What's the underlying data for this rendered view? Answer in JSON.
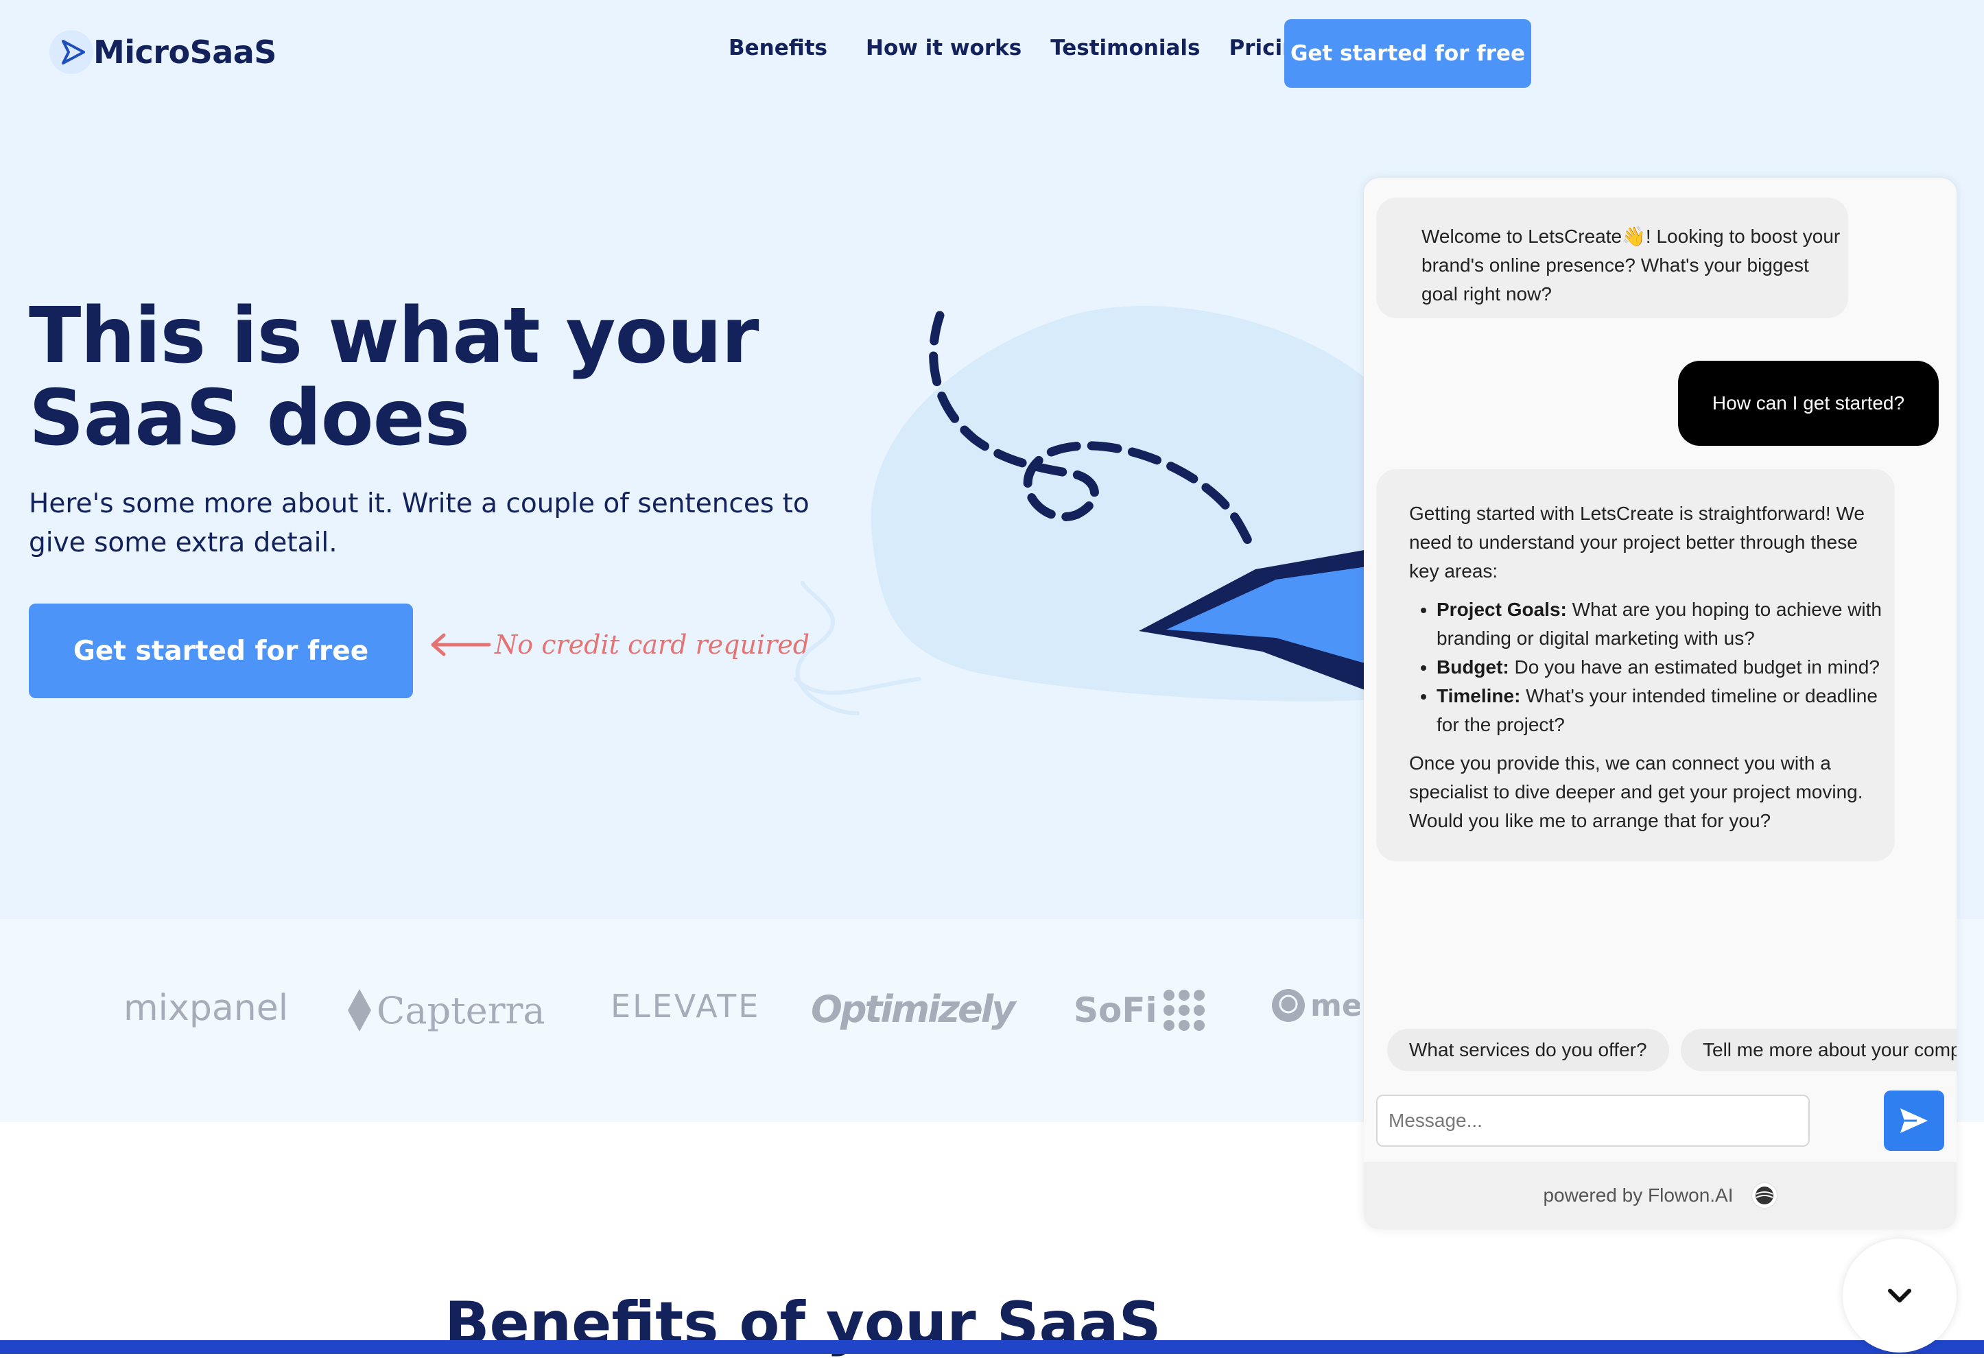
{
  "nav": {
    "logo_text": "MicroSaaS",
    "links": [
      "Benefits",
      "How it works",
      "Testimonials",
      "Pricing"
    ],
    "cta": "Get started for free"
  },
  "hero": {
    "title": "This is what your SaaS does",
    "subtitle": "Here's some more about it. Write a couple of sentences to give some extra detail.",
    "cta": "Get started for free",
    "note": "No credit card required"
  },
  "logos": [
    "mixpanel",
    "Capterra",
    "ELEVATE",
    "Optimizely",
    "SoFi",
    "men"
  ],
  "benefits": {
    "title": "Benefits of your SaaS"
  },
  "chat": {
    "bot_message_1": "Welcome to LetsCreate👋! Looking to boost your brand's online presence? What's your biggest goal right now?",
    "user_message_1": "How can I get started?",
    "bot_message_2": {
      "intro": "Getting started with LetsCreate is straightforward! We need to understand your project better through these key areas:",
      "items": [
        {
          "label": "Project Goals:",
          "text": " What are you hoping to achieve with branding or digital marketing with us?"
        },
        {
          "label": "Budget:",
          "text": " Do you have an estimated budget in mind?"
        },
        {
          "label": "Timeline:",
          "text": " What's your intended timeline or deadline for the project?"
        }
      ],
      "outro": "Once you provide this, we can connect you with a specialist to dive deeper and get your project moving. Would you like me to arrange that for you?"
    },
    "suggestions": [
      "What services do you offer?",
      "Tell me more about your comp"
    ],
    "input_placeholder": "Message...",
    "powered_by": "powered by Flowon.AI"
  },
  "colors": {
    "brand_navy": "#14225c",
    "primary_blue": "#4d94f8",
    "hero_bg": "#e9f4fe",
    "chat_send": "#2f7ff0",
    "note_red": "#e57373"
  },
  "icons": {
    "logo": "play-triangle-icon",
    "arrow": "arrow-left-icon",
    "send": "send-icon",
    "collapse": "chevron-down-icon"
  }
}
